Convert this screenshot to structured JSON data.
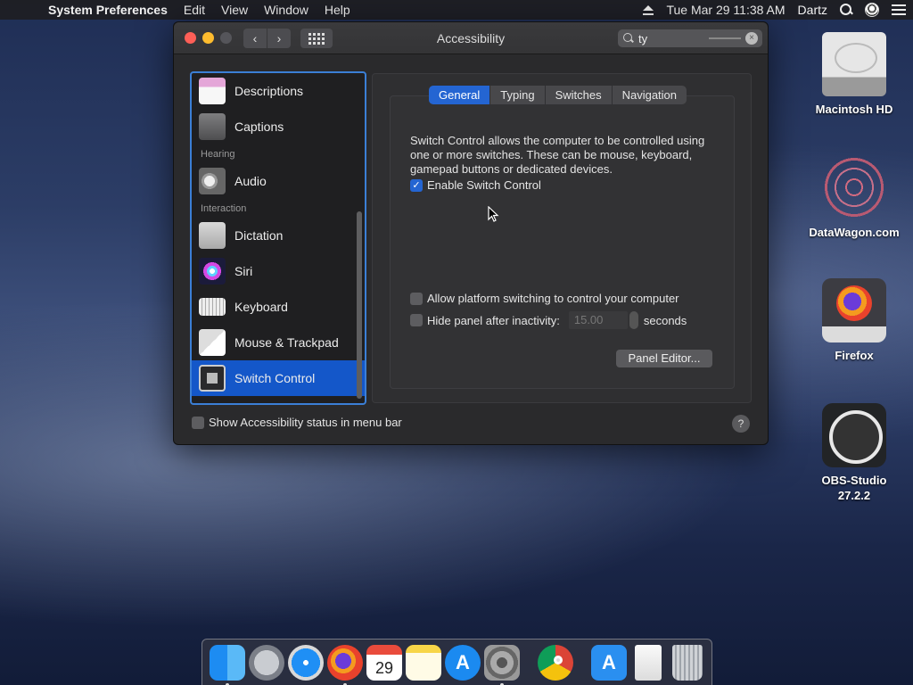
{
  "menubar": {
    "app_name": "System Preferences",
    "menus": [
      "Edit",
      "View",
      "Window",
      "Help"
    ],
    "clock": "Tue Mar 29  11:38 AM",
    "user": "Dartz"
  },
  "window": {
    "title": "Accessibility",
    "search_value": "ty",
    "sidebar": {
      "items": [
        {
          "label": "Descriptions",
          "icon": "descriptions-icon"
        },
        {
          "label": "Captions",
          "icon": "captions-icon"
        },
        {
          "section": "Hearing"
        },
        {
          "label": "Audio",
          "icon": "speaker-icon"
        },
        {
          "section": "Interaction"
        },
        {
          "label": "Dictation",
          "icon": "microphone-icon"
        },
        {
          "label": "Siri",
          "icon": "siri-icon"
        },
        {
          "label": "Keyboard",
          "icon": "keyboard-icon"
        },
        {
          "label": "Mouse & Trackpad",
          "icon": "mouse-trackpad-icon"
        },
        {
          "label": "Switch Control",
          "icon": "switch-control-icon",
          "selected": true
        }
      ]
    },
    "tabs": [
      {
        "label": "General",
        "active": true
      },
      {
        "label": "Typing"
      },
      {
        "label": "Switches"
      },
      {
        "label": "Navigation"
      }
    ],
    "description": "Switch Control allows the computer to be controlled using one or more switches. These can be mouse, keyboard, gamepad buttons or dedicated devices.",
    "enable_switch": {
      "label": "Enable Switch Control",
      "checked": true
    },
    "platform_switching": {
      "label": "Allow platform switching to control your computer",
      "checked": false
    },
    "hide_panel": {
      "label": "Hide panel after inactivity:",
      "value": "15.00",
      "unit": "seconds",
      "checked": false
    },
    "panel_editor_label": "Panel Editor...",
    "status_menu": {
      "label": "Show Accessibility status in menu bar",
      "checked": false
    },
    "help_label": "?"
  },
  "desktop": {
    "icons": [
      {
        "label": "Macintosh HD"
      },
      {
        "label": "DataWagon.com"
      },
      {
        "label": "Firefox"
      },
      {
        "label": "OBS-Studio\n27.2.2"
      }
    ]
  },
  "dock": {
    "calendar_month": "MAR",
    "calendar_day": "29",
    "apps": [
      "Finder",
      "Launchpad",
      "Safari",
      "Firefox",
      "Calendar",
      "Notes",
      "App Store",
      "System Preferences",
      "Google Chrome",
      "App Store",
      "Document",
      "Trash"
    ]
  },
  "colors": {
    "accent": "#2465d2",
    "selection": "#1457c9",
    "sidebar_focus": "#3b7fd6"
  }
}
